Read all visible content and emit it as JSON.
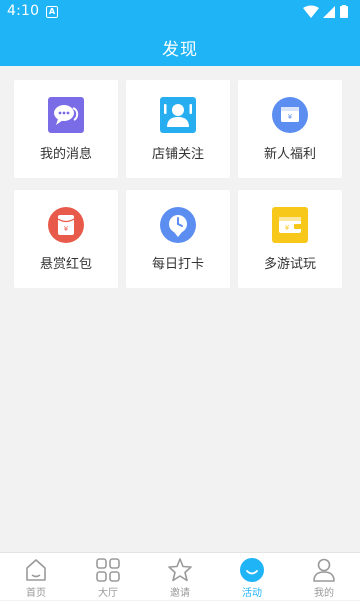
{
  "status_bar": {
    "time": "4:10",
    "badge": "A"
  },
  "header": {
    "title": "发现"
  },
  "cards": [
    {
      "label": "我的消息",
      "icon": "chat-bubbles-icon",
      "color": "#7a6be6"
    },
    {
      "label": "店铺关注",
      "icon": "person-icon",
      "color": "#27aef0"
    },
    {
      "label": "新人福利",
      "icon": "gift-card-icon",
      "color": "#5b8ef0"
    },
    {
      "label": "悬赏红包",
      "icon": "red-envelope-icon",
      "color": "#e85b4a"
    },
    {
      "label": "每日打卡",
      "icon": "clock-icon",
      "color": "#5b8ef0"
    },
    {
      "label": "多游试玩",
      "icon": "wallet-icon",
      "color": "#f7c81a"
    }
  ],
  "tabbar": {
    "active_color": "#1fb4f6",
    "tabs": [
      {
        "label": "首页",
        "icon": "home-icon"
      },
      {
        "label": "大厅",
        "icon": "grid-icon"
      },
      {
        "label": "邀请",
        "icon": "star-icon"
      },
      {
        "label": "活动",
        "icon": "smile-icon",
        "active": true
      },
      {
        "label": "我的",
        "icon": "user-icon"
      }
    ]
  }
}
